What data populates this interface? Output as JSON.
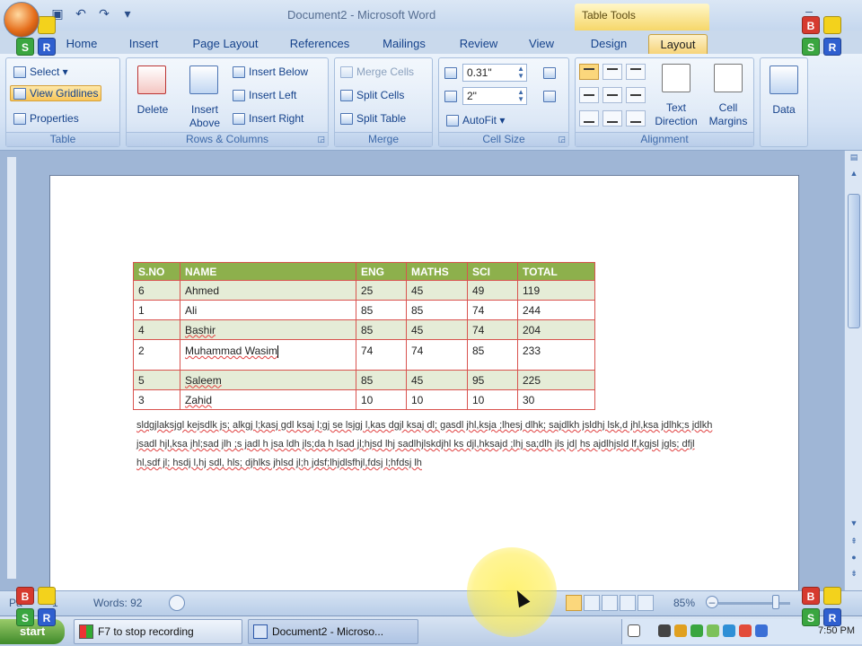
{
  "window": {
    "title": "Document2 - Microsoft Word",
    "contextual_label": "Table Tools"
  },
  "qat": {
    "save_icon": "save-icon",
    "undo_icon": "undo-icon",
    "redo_icon": "redo-icon",
    "customize": "▾"
  },
  "tabs": [
    {
      "label": "Home"
    },
    {
      "label": "Insert"
    },
    {
      "label": "Page Layout"
    },
    {
      "label": "References"
    },
    {
      "label": "Mailings"
    },
    {
      "label": "Review"
    },
    {
      "label": "View"
    },
    {
      "label": "Design"
    },
    {
      "label": "Layout"
    }
  ],
  "ribbon": {
    "table": {
      "label": "Table",
      "select": "Select ▾",
      "view_gridlines": "View Gridlines",
      "properties": "Properties"
    },
    "rows_columns": {
      "label": "Rows & Columns",
      "delete": "Delete",
      "insert_above": "Insert\nAbove",
      "insert_below": "Insert Below",
      "insert_left": "Insert Left",
      "insert_right": "Insert Right"
    },
    "merge": {
      "label": "Merge",
      "merge_cells": "Merge Cells",
      "split_cells": "Split Cells",
      "split_table": "Split Table"
    },
    "cell_size": {
      "label": "Cell Size",
      "height": "0.31\"",
      "width": "2\"",
      "autofit": "AutoFit ▾"
    },
    "alignment": {
      "label": "Alignment",
      "text_direction": "Text\nDirection",
      "cell_margins": "Cell\nMargins"
    },
    "data": {
      "label": "Data"
    }
  },
  "table": {
    "headers": [
      "S.NO",
      "NAME",
      "ENG",
      "MATHS",
      "SCI",
      "TOTAL"
    ],
    "rows": [
      [
        "6",
        "Ahmed",
        "25",
        "45",
        "49",
        "119"
      ],
      [
        "1",
        "Ali",
        "85",
        "85",
        "74",
        "244"
      ],
      [
        "4",
        "Bashir",
        "85",
        "45",
        "74",
        "204"
      ],
      [
        "2",
        "Muhammad Wasim",
        "74",
        "74",
        "85",
        "233"
      ],
      [
        "5",
        "Saleem",
        "85",
        "45",
        "95",
        "225"
      ],
      [
        "3",
        "Zahid",
        "10",
        "10",
        "10",
        "30"
      ]
    ]
  },
  "paragraph": "sldgjlaksjgl kejsdlk js; alkgj l;kasj gdl ksaj l;gj se lsjgj l,kas dgjl ksaj dl; gasdl jhl,ksja ;lhesj dlhk; sajdlkh jsldhj lsk,d jhl,ksa jdlhk;s jdlkh jsadl hjl,ksa jhl;sad jlh ;s jadl h jsa ldh jls;da h lsad jl;hjsd lhj sadlhjlskdjhl ks djl,hksajd ;lhj sa;dlh jls jd| hs ajdlhjsld lf,kgjsl jgls; dfjl hl,sdf jl; hsdj l,hj sdl, hls; djhlks jhlsd jl;h jdsf;lhjdlsfhjl,fdsj l;hfdsj lh",
  "status": {
    "page": "Pa",
    "page_num": "1",
    "words": "Words: 92",
    "zoom": "85%"
  },
  "taskbar": {
    "start": "start",
    "task1": "F7 to stop recording",
    "task2": "Document2 - Microso...",
    "clock": "7:50 PM"
  },
  "badges": {
    "red": "B",
    "yellow": "",
    "green": "S",
    "blue": "R"
  },
  "colors": {
    "table_header": "#8db04c",
    "table_border": "#d9534f",
    "shade": "#e5ecd7",
    "accent": "#f6d47a"
  }
}
